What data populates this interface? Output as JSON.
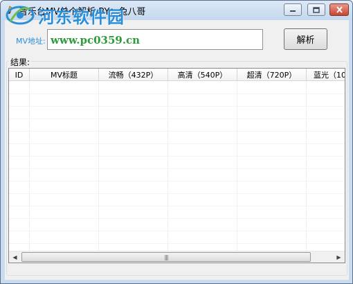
{
  "window": {
    "title": "音乐台MV单个解析 BY：兔八哥",
    "icon": "app-icon",
    "controls": {
      "minimize_icon": "minimize-icon",
      "maximize_icon": "maximize-icon",
      "close_icon": "close-icon"
    }
  },
  "watermark": {
    "name": "河东软件园"
  },
  "form": {
    "url_label": "MV地址:",
    "url_value": "www.pc0359.cn",
    "parse_button": "解析"
  },
  "results": {
    "group_label": "结果:",
    "columns": [
      "ID",
      "MV标题",
      "流畅（432P）",
      "高清（540P）",
      "超清（720P）",
      "蓝光（10"
    ],
    "rows": []
  },
  "scrollbar": {
    "left_icon": "scroll-left-icon",
    "right_icon": "scroll-right-icon",
    "grip_icon": "grip-icon"
  },
  "colors": {
    "watermark_blue": "#2a8fd8",
    "url_green": "#2f9a3a",
    "close_red": "#c7452f"
  }
}
